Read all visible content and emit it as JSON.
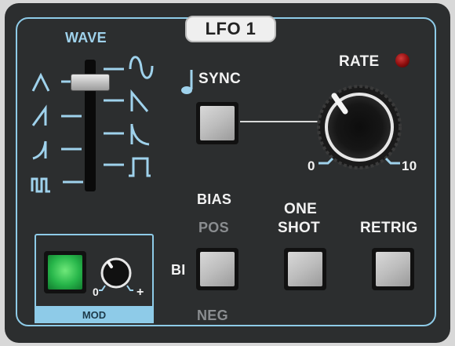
{
  "title": "LFO 1",
  "wave": {
    "label": "WAVE",
    "left_shapes": [
      "triangle-wave-icon",
      "saw-up-wave-icon",
      "exp-saw-up-wave-icon",
      "square-pulse-wave-icon"
    ],
    "right_shapes": [
      "sine-wave-icon",
      "saw-down-wave-icon",
      "exp-saw-down-wave-icon",
      "square-wave-icon"
    ]
  },
  "sync": {
    "label": "SYNC",
    "note_icon": "music-note-icon"
  },
  "rate": {
    "label": "RATE",
    "min": "0",
    "max": "10"
  },
  "bias": {
    "label": "BIAS",
    "pos": "POS",
    "bi": "BI",
    "neg": "NEG"
  },
  "one_shot": {
    "line1": "ONE",
    "line2": "SHOT"
  },
  "retrig": {
    "label": "RETRIG"
  },
  "mod": {
    "label": "MOD",
    "min": "0",
    "max": "+"
  },
  "colors": {
    "panel": "#2c2e2f",
    "accent": "#8ecbe8",
    "led": "#b01515",
    "mod_button": "#27b64a"
  }
}
